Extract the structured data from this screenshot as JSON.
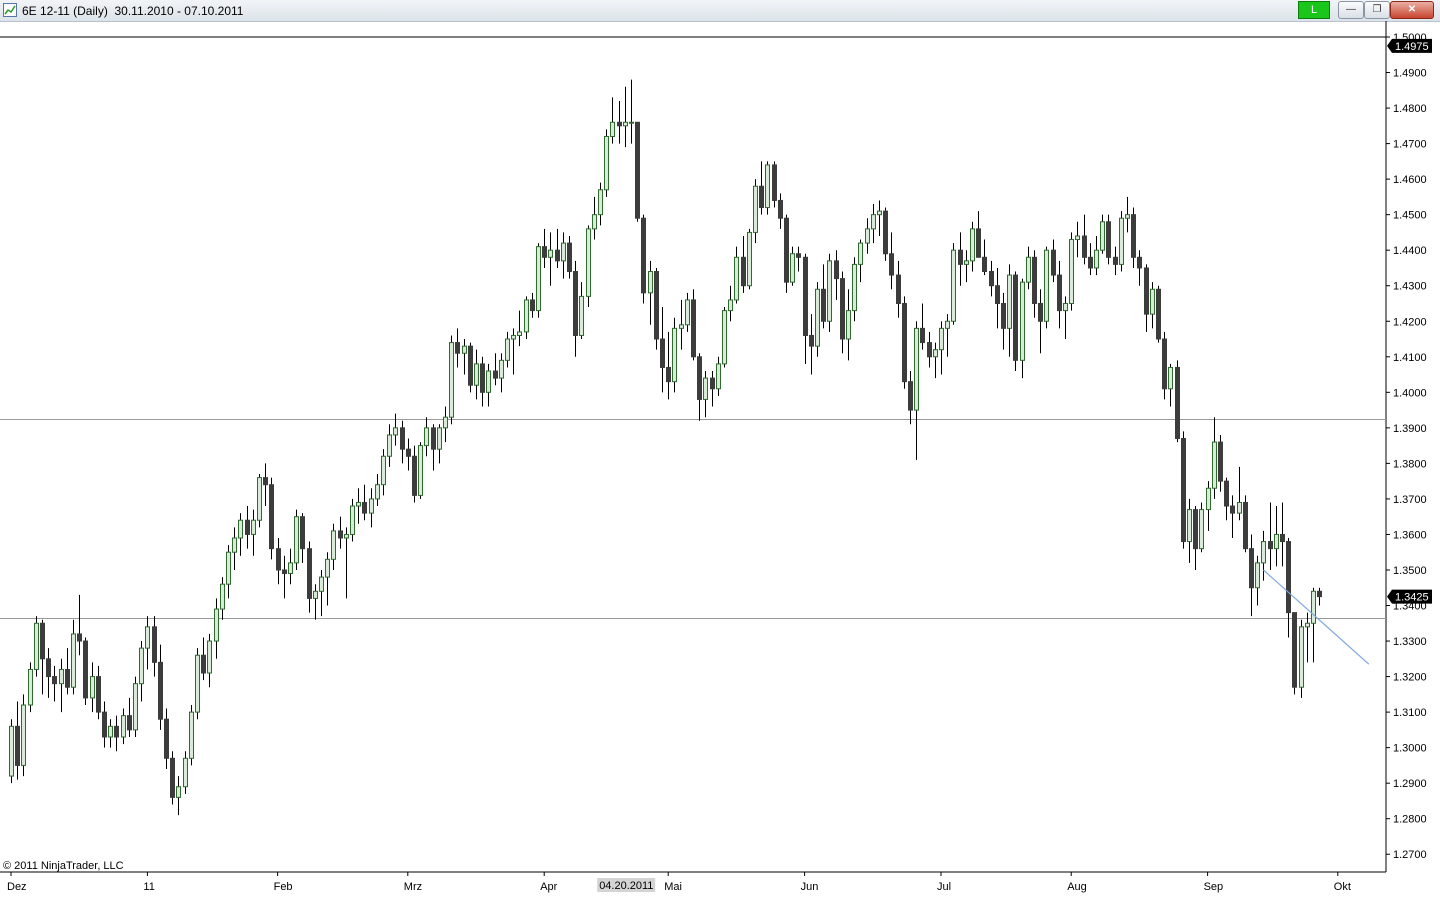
{
  "window": {
    "title": "6E 12-11 (Daily)  30.11.2010 - 07.10.2011",
    "status_label": "L",
    "minimize_label": "—",
    "maximize_label": "❐",
    "close_label": "✕",
    "icon": "chart-icon"
  },
  "footer": {
    "copyright": "© 2011 NinjaTrader, LLC"
  },
  "colors": {
    "up_body": "#d7ebd7",
    "up_outline": "#2f6b2f",
    "down_body": "#3c3c3c",
    "wick": "#000000",
    "hline": "#9a9a9a",
    "trendline": "#7ea6e0",
    "badge_bg": "#000000",
    "badge_text": "#ffffff",
    "status_green": "#1bc61b"
  },
  "chart_data": {
    "type": "candlestick",
    "title": "6E 12-11 (Daily)",
    "ylim": [
      1.265,
      1.5
    ],
    "y_ticks": [
      1.5,
      1.49,
      1.48,
      1.47,
      1.46,
      1.45,
      1.44,
      1.43,
      1.42,
      1.41,
      1.4,
      1.39,
      1.38,
      1.37,
      1.36,
      1.35,
      1.34,
      1.33,
      1.32,
      1.31,
      1.3,
      1.29,
      1.28,
      1.27
    ],
    "y_tick_labels": [
      "1.5000",
      "1.4900",
      "1.4800",
      "1.4700",
      "1.4600",
      "1.4500",
      "1.4400",
      "1.4300",
      "1.4200",
      "1.4100",
      "1.4000",
      "1.3900",
      "1.3800",
      "1.3700",
      "1.3600",
      "1.3500",
      "1.3400",
      "1.3300",
      "1.3200",
      "1.3100",
      "1.3000",
      "1.2900",
      "1.2800",
      "1.2700"
    ],
    "x_labels": [
      "Dez",
      "11",
      "Feb",
      "Mrz",
      "Apr",
      "Mai",
      "Jun",
      "Jul",
      "Aug",
      "Sep",
      "Okt"
    ],
    "x_label_bar_index": [
      0,
      22,
      43,
      64,
      86,
      106,
      128,
      150,
      171,
      193,
      214
    ],
    "cursor_date_label": "04.20.2011",
    "cursor_bar_index": 101,
    "top_badge": {
      "label": "1.4975",
      "value": 1.4975
    },
    "last_price_badge": {
      "label": "1.3425",
      "value": 1.3425
    },
    "horizontal_lines": [
      1.3925,
      1.3365
    ],
    "trendline": {
      "from": [
        {
          "bar": 202,
          "value": 1.35
        }
      ],
      "to": [
        {
          "bar": 219,
          "value": 1.3235
        }
      ]
    },
    "candles": [
      [
        1.292,
        1.308,
        1.29,
        1.306
      ],
      [
        1.306,
        1.313,
        1.291,
        1.295
      ],
      [
        1.295,
        1.315,
        1.292,
        1.312
      ],
      [
        1.312,
        1.324,
        1.31,
        1.322
      ],
      [
        1.322,
        1.337,
        1.32,
        1.335
      ],
      [
        1.335,
        1.336,
        1.315,
        1.325
      ],
      [
        1.325,
        1.328,
        1.314,
        1.32
      ],
      [
        1.32,
        1.323,
        1.313,
        1.318
      ],
      [
        1.318,
        1.325,
        1.31,
        1.322
      ],
      [
        1.322,
        1.328,
        1.315,
        1.317
      ],
      [
        1.317,
        1.336,
        1.315,
        1.332
      ],
      [
        1.332,
        1.343,
        1.326,
        1.33
      ],
      [
        1.33,
        1.331,
        1.312,
        1.314
      ],
      [
        1.314,
        1.324,
        1.31,
        1.32
      ],
      [
        1.32,
        1.323,
        1.308,
        1.31
      ],
      [
        1.31,
        1.313,
        1.3,
        1.303
      ],
      [
        1.303,
        1.308,
        1.3,
        1.306
      ],
      [
        1.306,
        1.309,
        1.299,
        1.303
      ],
      [
        1.303,
        1.311,
        1.301,
        1.309
      ],
      [
        1.309,
        1.314,
        1.303,
        1.305
      ],
      [
        1.305,
        1.32,
        1.303,
        1.318
      ],
      [
        1.318,
        1.33,
        1.313,
        1.328
      ],
      [
        1.328,
        1.337,
        1.322,
        1.334
      ],
      [
        1.334,
        1.337,
        1.32,
        1.324
      ],
      [
        1.324,
        1.329,
        1.305,
        1.308
      ],
      [
        1.308,
        1.311,
        1.294,
        1.297
      ],
      [
        1.297,
        1.299,
        1.284,
        1.286
      ],
      [
        1.286,
        1.292,
        1.281,
        1.289
      ],
      [
        1.289,
        1.299,
        1.287,
        1.297
      ],
      [
        1.297,
        1.312,
        1.295,
        1.31
      ],
      [
        1.31,
        1.328,
        1.308,
        1.326
      ],
      [
        1.326,
        1.331,
        1.319,
        1.321
      ],
      [
        1.321,
        1.332,
        1.317,
        1.33
      ],
      [
        1.33,
        1.342,
        1.325,
        1.339
      ],
      [
        1.339,
        1.348,
        1.336,
        1.346
      ],
      [
        1.346,
        1.357,
        1.342,
        1.355
      ],
      [
        1.355,
        1.362,
        1.35,
        1.359
      ],
      [
        1.359,
        1.366,
        1.354,
        1.364
      ],
      [
        1.364,
        1.368,
        1.356,
        1.36
      ],
      [
        1.36,
        1.367,
        1.354,
        1.364
      ],
      [
        1.364,
        1.377,
        1.362,
        1.376
      ],
      [
        1.376,
        1.38,
        1.368,
        1.374
      ],
      [
        1.374,
        1.376,
        1.353,
        1.356
      ],
      [
        1.356,
        1.359,
        1.346,
        1.35
      ],
      [
        1.35,
        1.354,
        1.342,
        1.349
      ],
      [
        1.349,
        1.356,
        1.346,
        1.352
      ],
      [
        1.352,
        1.367,
        1.35,
        1.365
      ],
      [
        1.365,
        1.366,
        1.352,
        1.356
      ],
      [
        1.356,
        1.358,
        1.338,
        1.342
      ],
      [
        1.342,
        1.346,
        1.336,
        1.344
      ],
      [
        1.344,
        1.35,
        1.337,
        1.348
      ],
      [
        1.348,
        1.355,
        1.34,
        1.353
      ],
      [
        1.353,
        1.363,
        1.35,
        1.361
      ],
      [
        1.361,
        1.365,
        1.356,
        1.359
      ],
      [
        1.359,
        1.362,
        1.342,
        1.36
      ],
      [
        1.36,
        1.37,
        1.358,
        1.368
      ],
      [
        1.368,
        1.373,
        1.363,
        1.369
      ],
      [
        1.369,
        1.374,
        1.364,
        1.366
      ],
      [
        1.366,
        1.373,
        1.362,
        1.37
      ],
      [
        1.37,
        1.377,
        1.368,
        1.374
      ],
      [
        1.374,
        1.384,
        1.371,
        1.382
      ],
      [
        1.382,
        1.391,
        1.379,
        1.388
      ],
      [
        1.388,
        1.394,
        1.385,
        1.39
      ],
      [
        1.39,
        1.392,
        1.38,
        1.384
      ],
      [
        1.384,
        1.387,
        1.378,
        1.382
      ],
      [
        1.382,
        1.385,
        1.369,
        1.371
      ],
      [
        1.371,
        1.386,
        1.37,
        1.385
      ],
      [
        1.385,
        1.393,
        1.382,
        1.39
      ],
      [
        1.39,
        1.391,
        1.378,
        1.384
      ],
      [
        1.384,
        1.391,
        1.38,
        1.39
      ],
      [
        1.39,
        1.396,
        1.386,
        1.393
      ],
      [
        1.393,
        1.416,
        1.391,
        1.414
      ],
      [
        1.414,
        1.418,
        1.407,
        1.411
      ],
      [
        1.411,
        1.415,
        1.405,
        1.413
      ],
      [
        1.413,
        1.414,
        1.4,
        1.402
      ],
      [
        1.402,
        1.412,
        1.398,
        1.408
      ],
      [
        1.408,
        1.41,
        1.396,
        1.4
      ],
      [
        1.4,
        1.408,
        1.396,
        1.406
      ],
      [
        1.406,
        1.411,
        1.402,
        1.404
      ],
      [
        1.404,
        1.411,
        1.4,
        1.409
      ],
      [
        1.409,
        1.417,
        1.407,
        1.415
      ],
      [
        1.415,
        1.418,
        1.405,
        1.416
      ],
      [
        1.416,
        1.423,
        1.413,
        1.417
      ],
      [
        1.417,
        1.427,
        1.415,
        1.426
      ],
      [
        1.426,
        1.428,
        1.421,
        1.423
      ],
      [
        1.423,
        1.442,
        1.421,
        1.441
      ],
      [
        1.441,
        1.446,
        1.435,
        1.438
      ],
      [
        1.438,
        1.445,
        1.43,
        1.44
      ],
      [
        1.44,
        1.446,
        1.435,
        1.437
      ],
      [
        1.437,
        1.445,
        1.432,
        1.442
      ],
      [
        1.442,
        1.444,
        1.432,
        1.434
      ],
      [
        1.434,
        1.437,
        1.41,
        1.416
      ],
      [
        1.416,
        1.431,
        1.415,
        1.427
      ],
      [
        1.427,
        1.447,
        1.424,
        1.446
      ],
      [
        1.446,
        1.455,
        1.443,
        1.45
      ],
      [
        1.45,
        1.459,
        1.447,
        1.457
      ],
      [
        1.457,
        1.474,
        1.455,
        1.472
      ],
      [
        1.472,
        1.483,
        1.47,
        1.476
      ],
      [
        1.476,
        1.482,
        1.47,
        1.475
      ],
      [
        1.475,
        1.486,
        1.469,
        1.476
      ],
      [
        1.476,
        1.488,
        1.47,
        1.476
      ],
      [
        1.476,
        1.476,
        1.448,
        1.449
      ],
      [
        1.449,
        1.45,
        1.425,
        1.428
      ],
      [
        1.428,
        1.437,
        1.419,
        1.434
      ],
      [
        1.434,
        1.435,
        1.412,
        1.415
      ],
      [
        1.415,
        1.424,
        1.4,
        1.407
      ],
      [
        1.407,
        1.417,
        1.398,
        1.403
      ],
      [
        1.403,
        1.421,
        1.4,
        1.418
      ],
      [
        1.418,
        1.426,
        1.412,
        1.419
      ],
      [
        1.419,
        1.428,
        1.417,
        1.426
      ],
      [
        1.426,
        1.429,
        1.409,
        1.41
      ],
      [
        1.41,
        1.411,
        1.392,
        1.398
      ],
      [
        1.398,
        1.406,
        1.393,
        1.404
      ],
      [
        1.404,
        1.406,
        1.396,
        1.401
      ],
      [
        1.401,
        1.41,
        1.399,
        1.408
      ],
      [
        1.408,
        1.424,
        1.407,
        1.423
      ],
      [
        1.423,
        1.43,
        1.42,
        1.426
      ],
      [
        1.426,
        1.441,
        1.425,
        1.438
      ],
      [
        1.438,
        1.444,
        1.428,
        1.43
      ],
      [
        1.43,
        1.446,
        1.429,
        1.445
      ],
      [
        1.445,
        1.46,
        1.442,
        1.458
      ],
      [
        1.458,
        1.465,
        1.45,
        1.452
      ],
      [
        1.452,
        1.465,
        1.45,
        1.464
      ],
      [
        1.464,
        1.465,
        1.452,
        1.454
      ],
      [
        1.454,
        1.456,
        1.446,
        1.449
      ],
      [
        1.449,
        1.45,
        1.428,
        1.431
      ],
      [
        1.431,
        1.441,
        1.43,
        1.439
      ],
      [
        1.439,
        1.441,
        1.434,
        1.438
      ],
      [
        1.438,
        1.439,
        1.408,
        1.416
      ],
      [
        1.416,
        1.422,
        1.405,
        1.413
      ],
      [
        1.413,
        1.431,
        1.41,
        1.429
      ],
      [
        1.429,
        1.436,
        1.418,
        1.42
      ],
      [
        1.42,
        1.439,
        1.417,
        1.437
      ],
      [
        1.437,
        1.44,
        1.426,
        1.432
      ],
      [
        1.432,
        1.434,
        1.411,
        1.415
      ],
      [
        1.415,
        1.429,
        1.409,
        1.423
      ],
      [
        1.423,
        1.438,
        1.42,
        1.436
      ],
      [
        1.436,
        1.443,
        1.431,
        1.442
      ],
      [
        1.442,
        1.449,
        1.439,
        1.446
      ],
      [
        1.446,
        1.453,
        1.442,
        1.45
      ],
      [
        1.45,
        1.454,
        1.444,
        1.451
      ],
      [
        1.451,
        1.452,
        1.437,
        1.439
      ],
      [
        1.439,
        1.445,
        1.429,
        1.433
      ],
      [
        1.433,
        1.437,
        1.421,
        1.425
      ],
      [
        1.425,
        1.427,
        1.401,
        1.403
      ],
      [
        1.403,
        1.406,
        1.391,
        1.395
      ],
      [
        1.395,
        1.42,
        1.381,
        1.418
      ],
      [
        1.418,
        1.425,
        1.412,
        1.414
      ],
      [
        1.414,
        1.417,
        1.407,
        1.41
      ],
      [
        1.41,
        1.414,
        1.404,
        1.412
      ],
      [
        1.412,
        1.42,
        1.405,
        1.418
      ],
      [
        1.418,
        1.422,
        1.41,
        1.42
      ],
      [
        1.42,
        1.442,
        1.419,
        1.44
      ],
      [
        1.44,
        1.445,
        1.43,
        1.436
      ],
      [
        1.436,
        1.44,
        1.431,
        1.437
      ],
      [
        1.437,
        1.448,
        1.434,
        1.446
      ],
      [
        1.446,
        1.451,
        1.439,
        1.438
      ],
      [
        1.438,
        1.443,
        1.433,
        1.434
      ],
      [
        1.434,
        1.437,
        1.427,
        1.43
      ],
      [
        1.43,
        1.435,
        1.418,
        1.425
      ],
      [
        1.425,
        1.428,
        1.412,
        1.418
      ],
      [
        1.418,
        1.436,
        1.41,
        1.433
      ],
      [
        1.433,
        1.434,
        1.406,
        1.409
      ],
      [
        1.409,
        1.432,
        1.404,
        1.431
      ],
      [
        1.431,
        1.441,
        1.429,
        1.438
      ],
      [
        1.438,
        1.44,
        1.421,
        1.425
      ],
      [
        1.425,
        1.429,
        1.411,
        1.42
      ],
      [
        1.42,
        1.441,
        1.418,
        1.44
      ],
      [
        1.44,
        1.443,
        1.431,
        1.433
      ],
      [
        1.433,
        1.437,
        1.418,
        1.423
      ],
      [
        1.423,
        1.427,
        1.415,
        1.425
      ],
      [
        1.425,
        1.445,
        1.423,
        1.443
      ],
      [
        1.443,
        1.448,
        1.438,
        1.444
      ],
      [
        1.444,
        1.45,
        1.436,
        1.438
      ],
      [
        1.438,
        1.442,
        1.433,
        1.435
      ],
      [
        1.435,
        1.444,
        1.433,
        1.44
      ],
      [
        1.44,
        1.45,
        1.439,
        1.448
      ],
      [
        1.448,
        1.45,
        1.436,
        1.438
      ],
      [
        1.438,
        1.441,
        1.433,
        1.436
      ],
      [
        1.436,
        1.451,
        1.434,
        1.449
      ],
      [
        1.449,
        1.455,
        1.445,
        1.45
      ],
      [
        1.45,
        1.452,
        1.435,
        1.438
      ],
      [
        1.438,
        1.44,
        1.43,
        1.435
      ],
      [
        1.435,
        1.436,
        1.417,
        1.422
      ],
      [
        1.422,
        1.431,
        1.418,
        1.429
      ],
      [
        1.429,
        1.43,
        1.414,
        1.415
      ],
      [
        1.415,
        1.417,
        1.398,
        1.401
      ],
      [
        1.401,
        1.408,
        1.396,
        1.407
      ],
      [
        1.407,
        1.409,
        1.386,
        1.387
      ],
      [
        1.387,
        1.389,
        1.356,
        1.358
      ],
      [
        1.358,
        1.37,
        1.352,
        1.367
      ],
      [
        1.367,
        1.368,
        1.35,
        1.356
      ],
      [
        1.356,
        1.369,
        1.355,
        1.367
      ],
      [
        1.367,
        1.375,
        1.361,
        1.373
      ],
      [
        1.373,
        1.393,
        1.37,
        1.386
      ],
      [
        1.386,
        1.388,
        1.372,
        1.375
      ],
      [
        1.375,
        1.376,
        1.364,
        1.368
      ],
      [
        1.368,
        1.371,
        1.359,
        1.366
      ],
      [
        1.366,
        1.379,
        1.364,
        1.369
      ],
      [
        1.369,
        1.371,
        1.355,
        1.356
      ],
      [
        1.356,
        1.36,
        1.337,
        1.345
      ],
      [
        1.345,
        1.354,
        1.34,
        1.352
      ],
      [
        1.352,
        1.361,
        1.347,
        1.358
      ],
      [
        1.358,
        1.369,
        1.35,
        1.356
      ],
      [
        1.356,
        1.368,
        1.351,
        1.36
      ],
      [
        1.36,
        1.369,
        1.351,
        1.358
      ],
      [
        1.358,
        1.359,
        1.331,
        1.338
      ],
      [
        1.338,
        1.338,
        1.315,
        1.317
      ],
      [
        1.317,
        1.336,
        1.314,
        1.334
      ],
      [
        1.334,
        1.338,
        1.324,
        1.335
      ],
      [
        1.335,
        1.345,
        1.324,
        1.344
      ],
      [
        1.344,
        1.345,
        1.34,
        1.3425
      ]
    ]
  }
}
